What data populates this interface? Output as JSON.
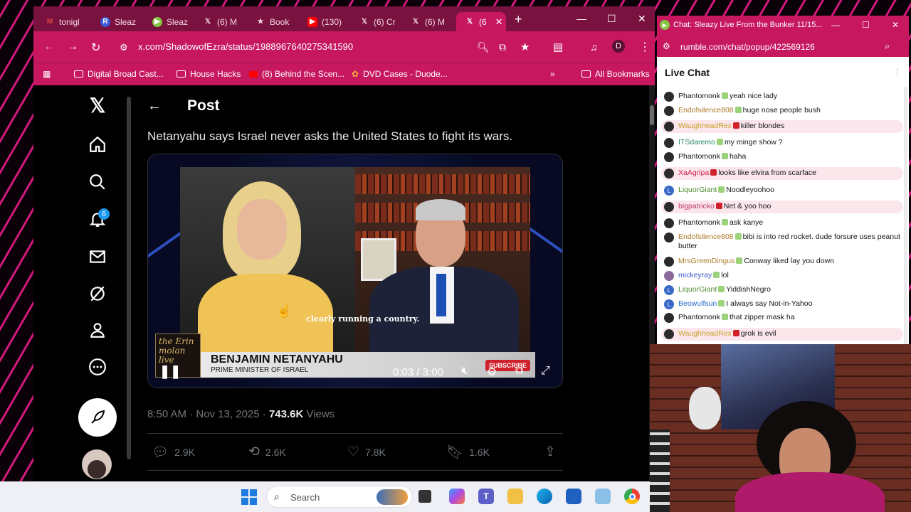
{
  "browser": {
    "tabs": [
      {
        "label": "tonigl",
        "icon": "gmail-icon",
        "color": "#d44638"
      },
      {
        "label": "Sleaz",
        "icon": "rumble-r-icon",
        "color": "#3a58d8"
      },
      {
        "label": "Sleaz",
        "icon": "rumble-play-icon",
        "color": "#85c742"
      },
      {
        "label": "(6) M",
        "icon": "x-icon",
        "color": "#000000"
      },
      {
        "label": "Book",
        "icon": "star-icon",
        "color": "#ffffff"
      },
      {
        "label": "(130)",
        "icon": "youtube-icon",
        "color": "#ff0000"
      },
      {
        "label": "(6) Cr",
        "icon": "x-icon",
        "color": "#000000"
      },
      {
        "label": "(6) M",
        "icon": "x-icon",
        "color": "#000000"
      },
      {
        "label": "(6",
        "icon": "x-icon",
        "color": "#000000"
      }
    ],
    "url": "x.com/ShadowofEzra/status/1988967640275341590",
    "profile_initial": "D",
    "bookmarks": [
      {
        "label": "Digital Broad Cast..."
      },
      {
        "label": "House Hacks"
      },
      {
        "label": "(8) Behind the Scen..."
      },
      {
        "label": "DVD Cases - Duode..."
      }
    ],
    "all_bookmarks": "All Bookmarks"
  },
  "x": {
    "notifications_count": "6",
    "post_header": "Post",
    "post_text": "Netanyahu says Israel never asks the United States to fight its wars.",
    "video": {
      "caption": "clearly running a country.",
      "logo_text": "the Erin molan live",
      "name": "BENJAMIN NETANYAHU",
      "title": "PRIME MINISTER OF ISRAEL",
      "time": "0:03 / 3:00",
      "subscribe": "SUBSCRIBE"
    },
    "meta_time": "8:50 AM · Nov 13, 2025 · ",
    "views_count": "743.6K",
    "views_label": " Views",
    "actions": {
      "replies": "2.9K",
      "reposts": "2.6K",
      "likes": "7.8K",
      "bookmarks": "1.6K"
    }
  },
  "chat": {
    "window_title": "Chat: Sleazy Live From the Bunker 11/15...",
    "url": "rumble.com/chat/popup/422569126",
    "header": "Live Chat",
    "messages": [
      {
        "user": "Phantomonk",
        "text": "yeah nice lady",
        "color": "#10151b",
        "hl": false
      },
      {
        "user": "Endofsilence808",
        "text": "huge nose people bush",
        "color": "#b07a2a",
        "hl": false
      },
      {
        "user": "WaughheadRex",
        "text": "killer blondes",
        "color": "#c9a128",
        "hl": true
      },
      {
        "user": "ITSdaremo",
        "text": "my minge show ?",
        "color": "#2a8a6a",
        "hl": false
      },
      {
        "user": "Phantomonk",
        "text": "haha",
        "color": "#10151b",
        "hl": false
      },
      {
        "user": "XaAgripa",
        "text": "looks like elvira from scarface",
        "color": "#d01f4a",
        "hl": true
      },
      {
        "user": "LiquorGiant",
        "text": "Noodleyoohoo",
        "color": "#4a8a2a",
        "hl": false
      },
      {
        "user": "bigpatricko",
        "text": "Net & yoo hoo",
        "color": "#c03a6a",
        "hl": true
      },
      {
        "user": "Phantomonk",
        "text": "ask kanye",
        "color": "#10151b",
        "hl": false
      },
      {
        "user": "Endofsilence808",
        "text": "bibi is into red rocket. dude forsure uses peanut butter",
        "color": "#b07a2a",
        "hl": false
      },
      {
        "user": "MrsGreenDingus",
        "text": "Conway liked lay you down",
        "color": "#b07a2a",
        "hl": false
      },
      {
        "user": "mickeyray",
        "text": "lol",
        "color": "#3a5ac8",
        "hl": false
      },
      {
        "user": "LiquorGiant",
        "text": "YiddishNegro",
        "color": "#4a8a2a",
        "hl": false
      },
      {
        "user": "Beowulfsun",
        "text": "I always say Not-in-Yahoo",
        "color": "#2a6ac8",
        "hl": false
      },
      {
        "user": "Phantomonk",
        "text": "that zipper mask ha",
        "color": "#10151b",
        "hl": false
      },
      {
        "user": "WaughheadRex",
        "text": "grok is evil",
        "color": "#c9a128",
        "hl": true
      }
    ]
  },
  "taskbar": {
    "search_placeholder": "Search"
  }
}
